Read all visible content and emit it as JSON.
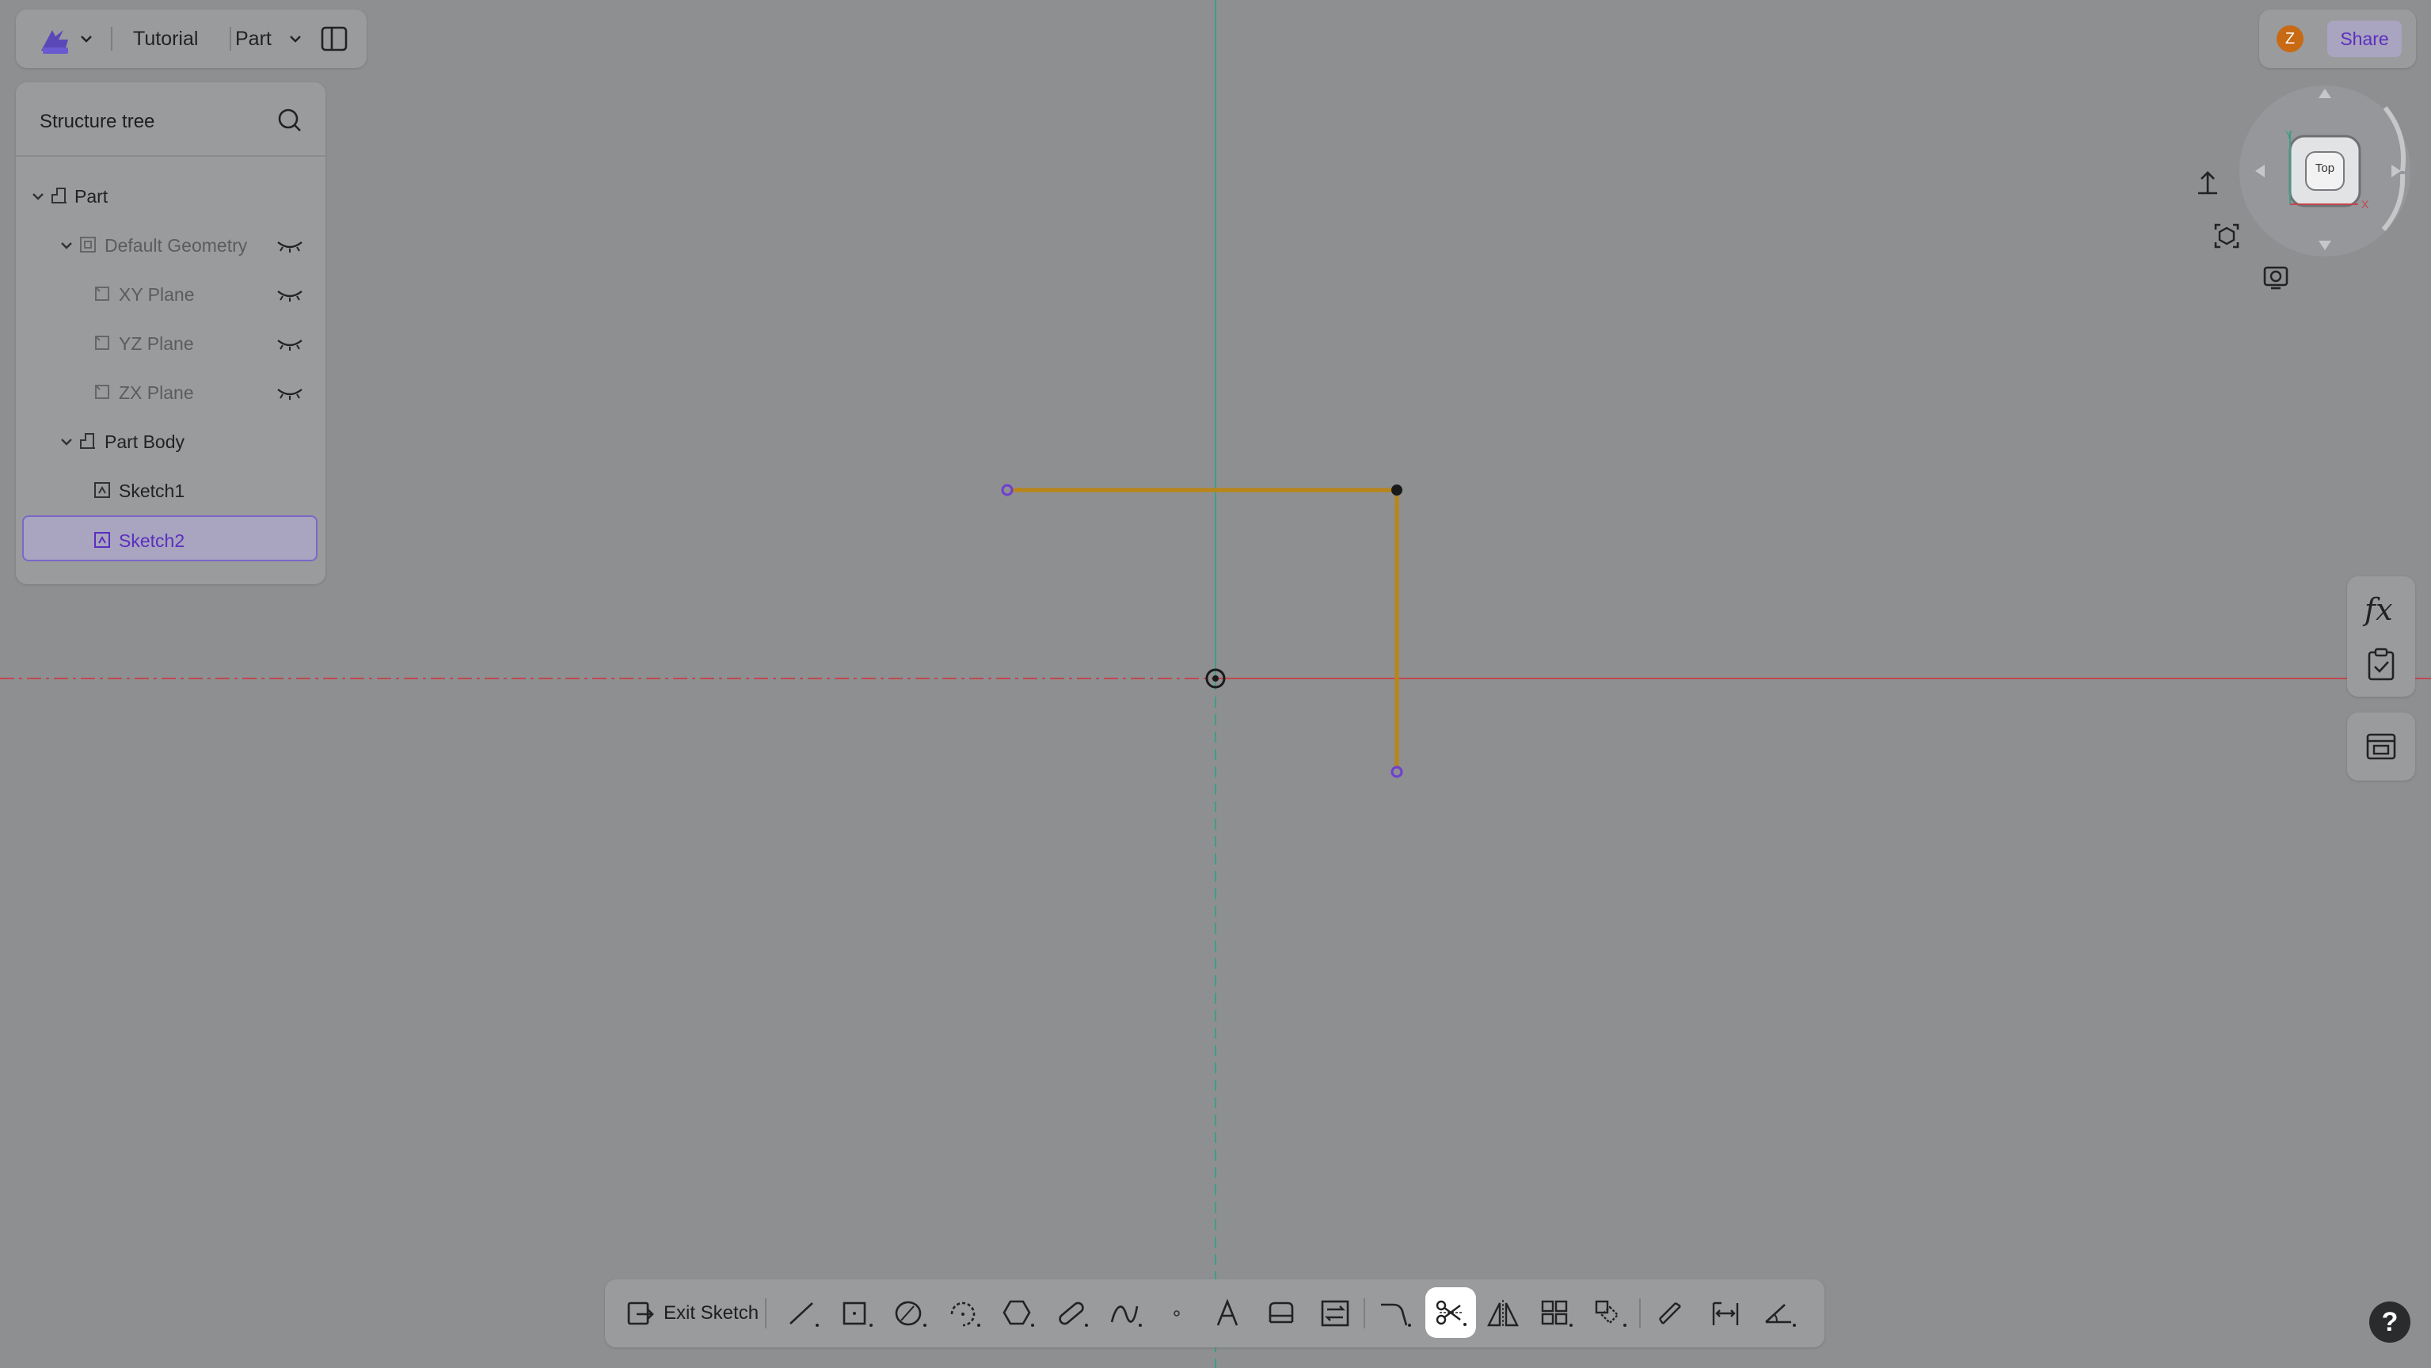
{
  "topbar": {
    "project_name": "Tutorial",
    "mode_label": "Part"
  },
  "tree": {
    "title": "Structure tree",
    "items": [
      {
        "label": "Part",
        "icon": "part-icon",
        "expanded": true
      },
      {
        "label": "Default Geometry",
        "icon": "geometry-icon",
        "expanded": true,
        "eye": "eye-closed-icon"
      },
      {
        "label": "XY Plane",
        "icon": "plane-icon",
        "eye": "eye-closed-icon"
      },
      {
        "label": "YZ Plane",
        "icon": "plane-icon",
        "eye": "eye-closed-icon"
      },
      {
        "label": "ZX Plane",
        "icon": "plane-icon",
        "eye": "eye-closed-icon"
      },
      {
        "label": "Part Body",
        "icon": "body-icon",
        "expanded": true
      },
      {
        "label": "Sketch1",
        "icon": "sketch-icon"
      },
      {
        "label": "Sketch2",
        "icon": "sketch-icon",
        "selected": true
      }
    ]
  },
  "user": {
    "avatar_letter": "Z",
    "share_label": "Share"
  },
  "viewcube": {
    "face_label": "Top",
    "axis_x": "X",
    "axis_y": "Y"
  },
  "side_panel": {
    "formula_label": "fx"
  },
  "toolbar": {
    "exit_label": "Exit Sketch",
    "tools": [
      "line-tool",
      "rectangle-tool",
      "circle-tool",
      "arc-tool",
      "polygon-tool",
      "slot-tool",
      "spline-tool",
      "point-tool",
      "text-tool",
      "offset-tool",
      "convert-tool",
      "fillet-tool",
      "trim-tool",
      "mirror-tool",
      "pattern-tool",
      "transform-tool",
      "dimension-tool",
      "constraint-tool",
      "angle-tool"
    ],
    "active_tool": "trim-tool"
  },
  "help_label": "?",
  "colors": {
    "background": "#8e8f91",
    "accent": "#7b68c8",
    "sketch_line": "#b98516",
    "x_axis": "#c2484f",
    "y_axis": "#3f9e86"
  }
}
